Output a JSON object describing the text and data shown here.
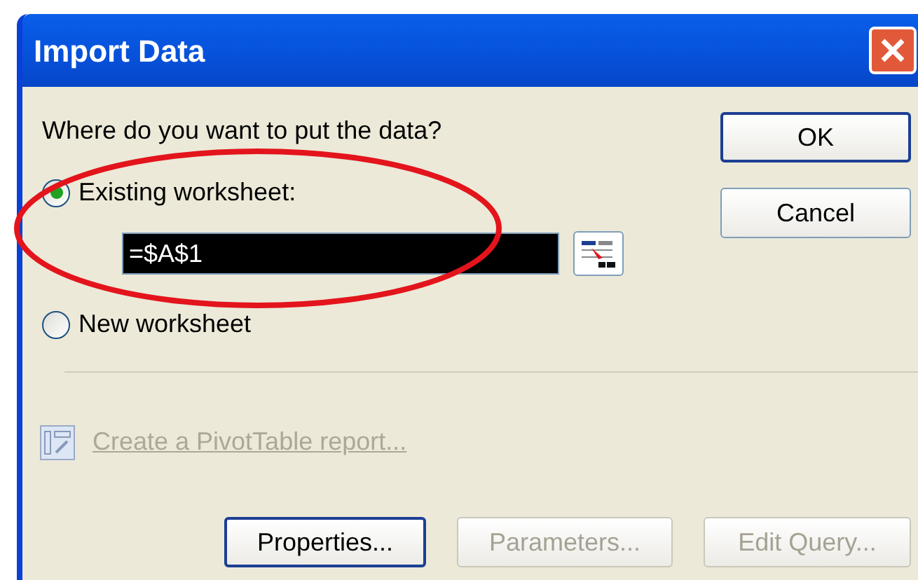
{
  "window": {
    "title": "Import Data"
  },
  "prompt": "Where do you want to put the data?",
  "destinations": [
    {
      "label": "Existing worksheet:",
      "selected": true
    },
    {
      "label": "New worksheet",
      "selected": false
    }
  ],
  "range_field": {
    "value": "=$A$1"
  },
  "pivot_link": {
    "label": "Create a PivotTable report...",
    "disabled": true
  },
  "side_buttons": [
    {
      "label": "OK",
      "focused": true
    },
    {
      "label": "Cancel",
      "focused": false
    }
  ],
  "bottom_buttons": [
    {
      "label": "Properties...",
      "disabled": false,
      "focused": true
    },
    {
      "label": "Parameters...",
      "disabled": true,
      "focused": false
    },
    {
      "label": "Edit Query...",
      "disabled": true,
      "focused": false
    }
  ],
  "annotation": {
    "kind": "ellipse"
  }
}
